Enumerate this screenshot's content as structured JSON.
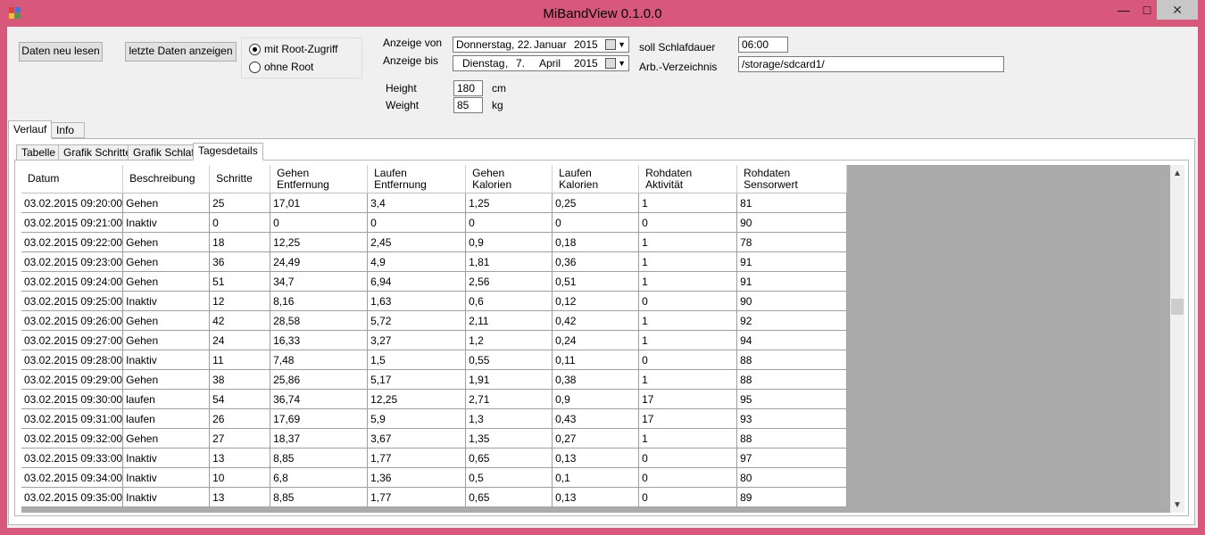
{
  "window": {
    "title": "MiBandView 0.1.0.0",
    "minimize": "—",
    "maximize": "□",
    "close": "✕"
  },
  "buttons": {
    "reload": "Daten neu lesen",
    "show_last": "letzte Daten anzeigen"
  },
  "root_options": {
    "with_root": "mit Root-Zugriff",
    "without_root": "ohne Root",
    "selected": "with_root"
  },
  "date_range": {
    "from_label": "Anzeige von",
    "to_label": "Anzeige bis",
    "from": {
      "weekday": "Donnerstag, 22.",
      "month": "Januar",
      "year": "2015"
    },
    "to": {
      "weekday": "Dienstag",
      "sep": ",",
      "day": "7.",
      "month": "April",
      "year": "2015"
    }
  },
  "body": {
    "height_label": "Height",
    "height_value": "180",
    "height_unit": "cm",
    "weight_label": "Weight",
    "weight_value": "85",
    "weight_unit": "kg"
  },
  "settings": {
    "sleep_label": "soll Schlafdauer",
    "sleep_value": "06:00",
    "dir_label": "Arb.-Verzeichnis",
    "dir_value": "/storage/sdcard1/"
  },
  "main_tabs": [
    "Verlauf",
    "Info"
  ],
  "sub_tabs": [
    "Tabelle",
    "Grafik Schritte",
    "Grafik Schlaf",
    "Tagesdetails"
  ],
  "table": {
    "columns": [
      [
        "Datum",
        ""
      ],
      [
        "Beschreibung",
        ""
      ],
      [
        "Schritte",
        ""
      ],
      [
        "Gehen",
        "Entfernung"
      ],
      [
        "Laufen",
        "Entfernung"
      ],
      [
        "Gehen",
        "Kalorien"
      ],
      [
        "Laufen",
        "Kalorien"
      ],
      [
        "Rohdaten",
        "Aktivität"
      ],
      [
        "Rohdaten",
        "Sensorwert"
      ]
    ],
    "rows": [
      [
        "03.02.2015 09:20:00",
        "Gehen",
        "25",
        "17,01",
        "3,4",
        "1,25",
        "0,25",
        "1",
        "81"
      ],
      [
        "03.02.2015 09:21:00",
        "Inaktiv",
        "0",
        "0",
        "0",
        "0",
        "0",
        "0",
        "90"
      ],
      [
        "03.02.2015 09:22:00",
        "Gehen",
        "18",
        "12,25",
        "2,45",
        "0,9",
        "0,18",
        "1",
        "78"
      ],
      [
        "03.02.2015 09:23:00",
        "Gehen",
        "36",
        "24,49",
        "4,9",
        "1,81",
        "0,36",
        "1",
        "91"
      ],
      [
        "03.02.2015 09:24:00",
        "Gehen",
        "51",
        "34,7",
        "6,94",
        "2,56",
        "0,51",
        "1",
        "91"
      ],
      [
        "03.02.2015 09:25:00",
        "Inaktiv",
        "12",
        "8,16",
        "1,63",
        "0,6",
        "0,12",
        "0",
        "90"
      ],
      [
        "03.02.2015 09:26:00",
        "Gehen",
        "42",
        "28,58",
        "5,72",
        "2,11",
        "0,42",
        "1",
        "92"
      ],
      [
        "03.02.2015 09:27:00",
        "Gehen",
        "24",
        "16,33",
        "3,27",
        "1,2",
        "0,24",
        "1",
        "94"
      ],
      [
        "03.02.2015 09:28:00",
        "Inaktiv",
        "11",
        "7,48",
        "1,5",
        "0,55",
        "0,11",
        "0",
        "88"
      ],
      [
        "03.02.2015 09:29:00",
        "Gehen",
        "38",
        "25,86",
        "5,17",
        "1,91",
        "0,38",
        "1",
        "88"
      ],
      [
        "03.02.2015 09:30:00",
        "laufen",
        "54",
        "36,74",
        "12,25",
        "2,71",
        "0,9",
        "17",
        "95"
      ],
      [
        "03.02.2015 09:31:00",
        "laufen",
        "26",
        "17,69",
        "5,9",
        "1,3",
        "0,43",
        "17",
        "93"
      ],
      [
        "03.02.2015 09:32:00",
        "Gehen",
        "27",
        "18,37",
        "3,67",
        "1,35",
        "0,27",
        "1",
        "88"
      ],
      [
        "03.02.2015 09:33:00",
        "Inaktiv",
        "13",
        "8,85",
        "1,77",
        "0,65",
        "0,13",
        "0",
        "97"
      ],
      [
        "03.02.2015 09:34:00",
        "Inaktiv",
        "10",
        "6,8",
        "1,36",
        "0,5",
        "0,1",
        "0",
        "80"
      ],
      [
        "03.02.2015 09:35:00",
        "Inaktiv",
        "13",
        "8,85",
        "1,77",
        "0,65",
        "0,13",
        "0",
        "89"
      ]
    ]
  },
  "scrollbar": {
    "up": "▲",
    "down": "▼"
  }
}
